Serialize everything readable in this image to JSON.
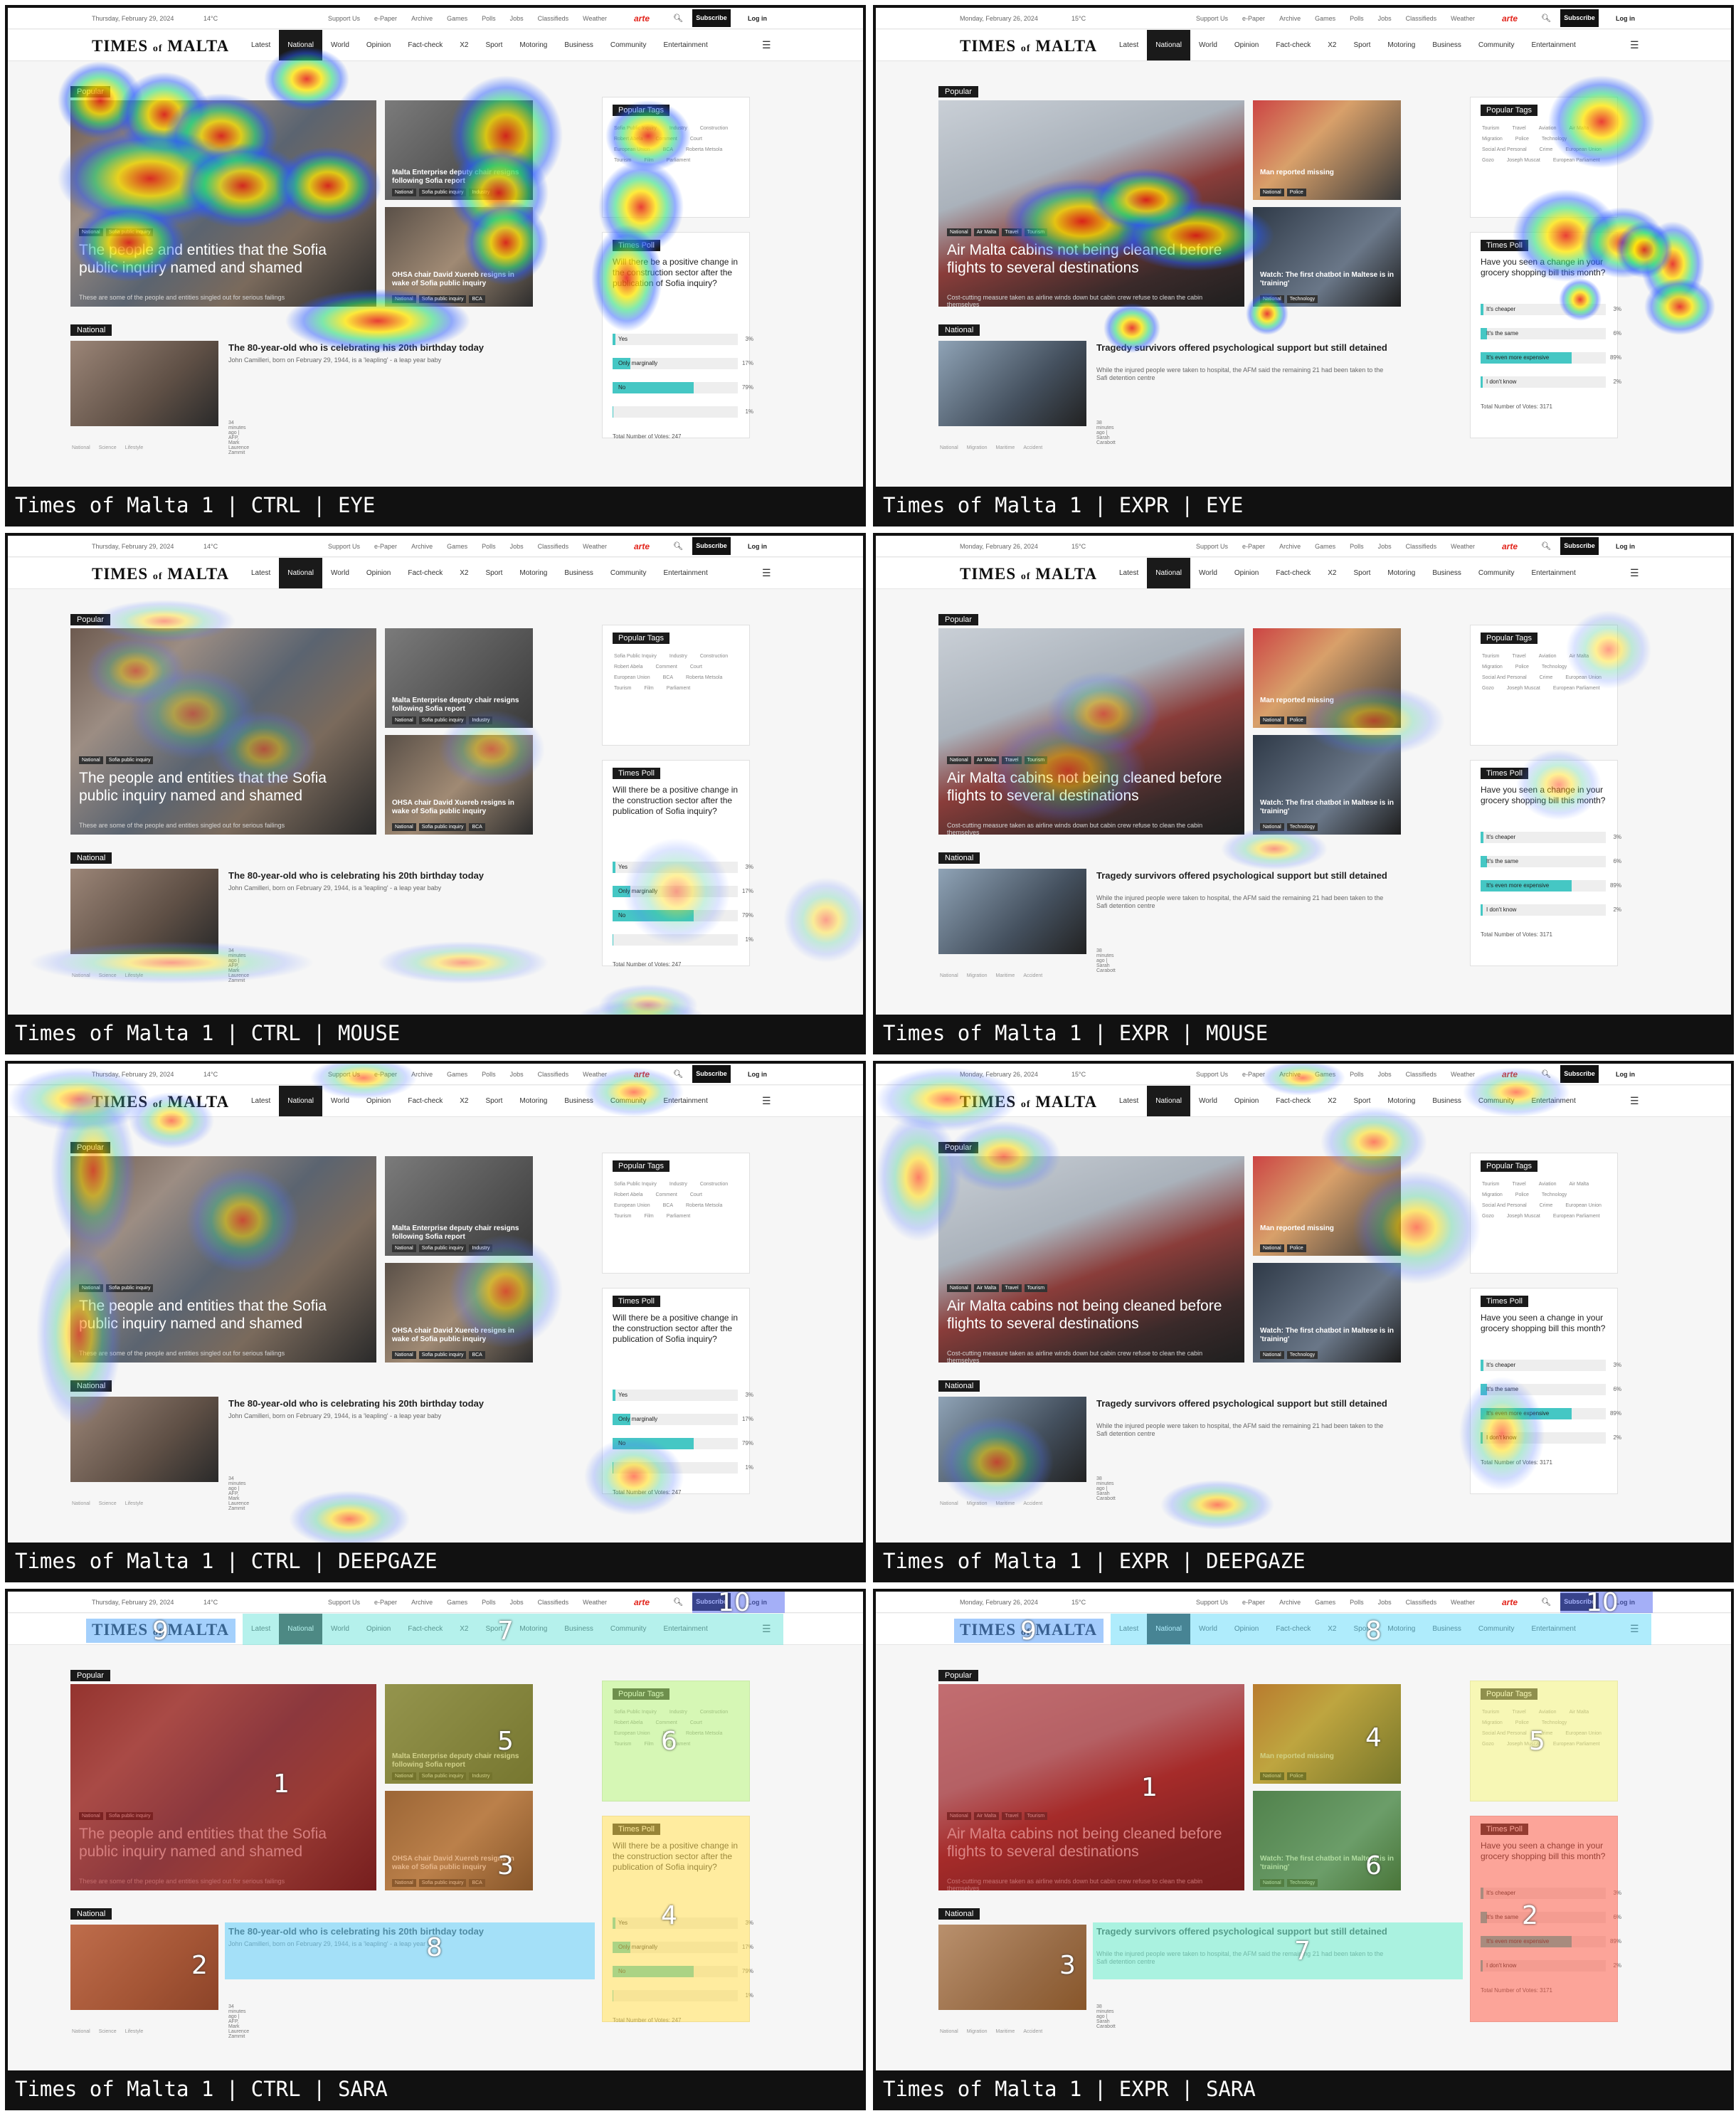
{
  "page": {
    "site": "Times of Malta 1",
    "sep": " | "
  },
  "conditions": {
    "ctrl": {
      "code": "CTRL",
      "date": "Thursday, February 29, 2024",
      "temp": "14°C",
      "section_label": "Popular",
      "hero": {
        "headline": "The people and entities that the Sofia public inquiry named and shamed",
        "sub": "These are some of the people and entities singled out for serious failings",
        "chips": [
          "National",
          "Sofia public inquiry"
        ]
      },
      "side1": {
        "headline": "Malta Enterprise deputy chair resigns following Sofia report",
        "chips": [
          "National",
          "Sofia public inquiry",
          "Industry"
        ]
      },
      "side2": {
        "headline": "OHSA chair David Xuereb resigns in wake of Sofia public inquiry",
        "chips": [
          "National",
          "Sofia public inquiry",
          "BCA"
        ]
      },
      "tags_title": "Popular Tags",
      "tags": [
        "Sofia Public Inquiry",
        "Industry",
        "Construction",
        "Robert Abela",
        "Comment",
        "Court",
        "European Union",
        "BCA",
        "Roberta Metsola",
        "Tourism",
        "Film",
        "Parliament"
      ],
      "poll": {
        "title": "Times Poll",
        "question": "Will there be a positive change in the construction sector after the publication of Sofia inquiry?",
        "options": [
          {
            "label": "Yes",
            "pct": "3%",
            "value": 3
          },
          {
            "label": "Only marginally",
            "pct": "17%",
            "value": 17
          },
          {
            "label": "No",
            "pct": "79%",
            "value": 79
          },
          {
            "label": "",
            "pct": "1%",
            "value": 1
          }
        ],
        "total": "Total Number of Votes: 247"
      },
      "national_label": "National",
      "article": {
        "headline": "The 80-year-old who is celebrating his 20th birthday today",
        "excerpt": "John Camilleri, born on February 29, 1944, is a 'leapling' - a leap year baby",
        "meta": "34 minutes ago | AFP, Mark Laurence Zammit",
        "chips": [
          "National",
          "Science",
          "Lifestyle"
        ]
      }
    },
    "expr": {
      "code": "EXPR",
      "date": "Monday, February 26, 2024",
      "temp": "15°C",
      "section_label": "Popular",
      "hero": {
        "headline": "Air Malta cabins not being cleaned before flights to several destinations",
        "sub": "Cost-cutting measure taken as airline winds down but cabin crew refuse to clean the cabin themselves",
        "chips": [
          "National",
          "Air Malta",
          "Travel",
          "Tourism"
        ]
      },
      "side1": {
        "headline": "Man reported missing",
        "chips": [
          "National",
          "Police"
        ]
      },
      "side2": {
        "headline": "Watch: The first chatbot in Maltese is in 'training'",
        "chips": [
          "National",
          "Technology"
        ]
      },
      "tags_title": "Popular Tags",
      "tags": [
        "Tourism",
        "Travel",
        "Aviation",
        "Air Malta",
        "Migration",
        "Police",
        "Technology",
        "Social And Personal",
        "Crime",
        "European Union",
        "Gozo",
        "Joseph Muscat",
        "European Parliament"
      ],
      "poll": {
        "title": "Times Poll",
        "question": "Have you seen a change in your grocery shopping bill this month?",
        "options": [
          {
            "label": "It's cheaper",
            "pct": "3%",
            "value": 3
          },
          {
            "label": "It's the same",
            "pct": "6%",
            "value": 6
          },
          {
            "label": "It's even more expensive",
            "pct": "89%",
            "value": 89
          },
          {
            "label": "I don't know",
            "pct": "2%",
            "value": 2
          }
        ],
        "total": "Total Number of Votes: 3171"
      },
      "national_label": "National",
      "article": {
        "headline": "Tragedy survivors offered psychological support but still detained",
        "excerpt": "While the injured people were taken to hospital, the AFM said the remaining 21 had been taken to the Safi detention centre",
        "meta": "38 minutes ago | Sarah Carabott",
        "chips": [
          "National",
          "Migration",
          "Maritime",
          "Accident"
        ]
      }
    }
  },
  "shared": {
    "toplinks": [
      "Support Us",
      "e-Paper",
      "Archive",
      "Games",
      "Polls",
      "Jobs",
      "Classifieds",
      "Weather"
    ],
    "arte": "arte",
    "subscribe": "Subscribe",
    "login": "Log in",
    "logo": "TIMES of MALTA",
    "nav": [
      "Latest",
      "National",
      "World",
      "Opinion",
      "Fact-check",
      "X2",
      "Sport",
      "Motoring",
      "Business",
      "Community",
      "Entertainment"
    ],
    "nav_active": "National"
  },
  "methods": [
    "EYE",
    "MOUSE",
    "DEEPGAZE",
    "SARA"
  ],
  "sara_ranks": {
    "ctrl": [
      "1",
      "2",
      "3",
      "4",
      "5",
      "6",
      "7",
      "8",
      "9",
      "10"
    ],
    "expr": [
      "1",
      "2",
      "3",
      "4",
      "5",
      "6",
      "7",
      "8",
      "9",
      "10"
    ]
  }
}
